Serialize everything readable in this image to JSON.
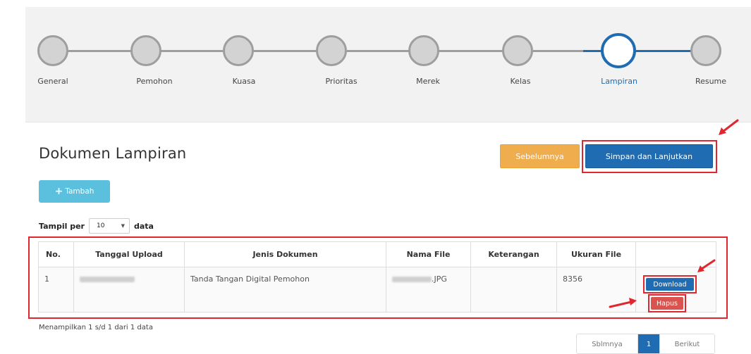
{
  "stepper": {
    "steps": [
      {
        "label": "General",
        "active": false
      },
      {
        "label": "Pemohon",
        "active": false
      },
      {
        "label": "Kuasa",
        "active": false
      },
      {
        "label": "Prioritas",
        "active": false
      },
      {
        "label": "Merek",
        "active": false
      },
      {
        "label": "Kelas",
        "active": false
      },
      {
        "label": "Lampiran",
        "active": true
      },
      {
        "label": "Resume",
        "active": false
      }
    ]
  },
  "page": {
    "title": "Dokumen Lampiran",
    "prev_button": "Sebelumnya",
    "next_button": "Simpan dan Lanjutkan",
    "add_button": "Tambah"
  },
  "length": {
    "prefix": "Tampil per",
    "value": "10",
    "suffix": "data"
  },
  "table": {
    "columns": [
      "No.",
      "Tanggal Upload",
      "Jenis Dokumen",
      "Nama File",
      "Keterangan",
      "Ukuran File",
      ""
    ],
    "rows": [
      {
        "no": "1",
        "jenis": "Tanda Tangan Digital Pemohon",
        "nama_ext": ".JPG",
        "keterangan": "",
        "ukuran": "8356",
        "download": "Download",
        "hapus": "Hapus"
      }
    ]
  },
  "info": "Menampilkan 1 s/d 1 dari 1 data",
  "pagination": {
    "prev": "Sblmnya",
    "current": "1",
    "next": "Berikut"
  },
  "colors": {
    "primary": "#1f6cb3",
    "warning": "#f0ad4e",
    "info": "#5bc0de",
    "danger": "#d9534f",
    "annotation": "#e0272f"
  }
}
